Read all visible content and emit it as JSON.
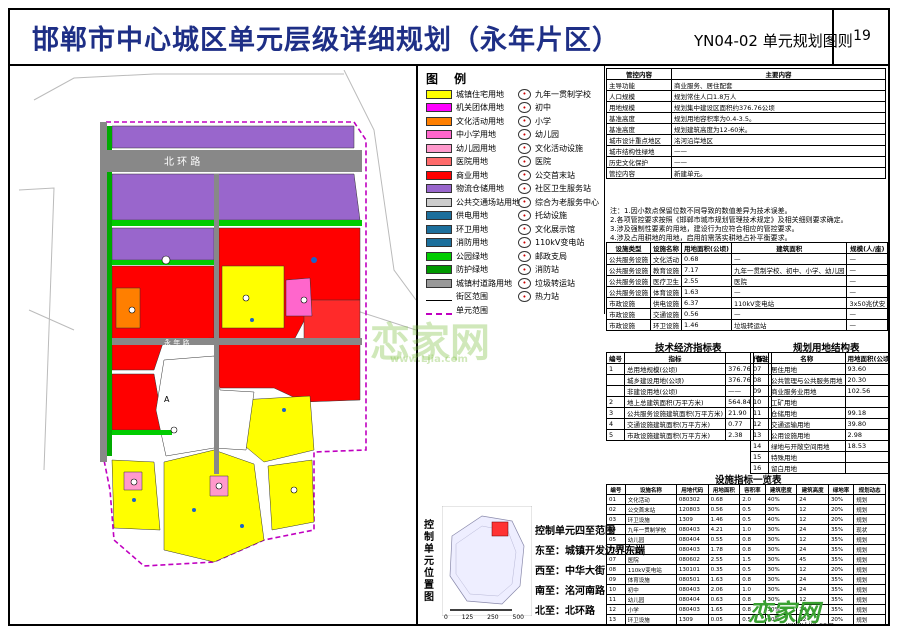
{
  "title": {
    "main": "邯郸市中心城区单元层级详细规划（永年片区）",
    "code": "YN04-02 单元规划图则",
    "page": "19"
  },
  "legend": {
    "heading": "图 例",
    "landuse": [
      {
        "label": "城镇住宅用地",
        "color": "#ffff00"
      },
      {
        "label": "机关团体用地",
        "color": "#ff00ff"
      },
      {
        "label": "文化活动用地",
        "color": "#ff7f00"
      },
      {
        "label": "中小学用地",
        "color": "#ff66cc"
      },
      {
        "label": "幼儿园用地",
        "color": "#ff99cc"
      },
      {
        "label": "医院用地",
        "color": "#ff6b6b"
      },
      {
        "label": "商业用地",
        "color": "#ff0000"
      },
      {
        "label": "物流仓储用地",
        "color": "#9966cc"
      },
      {
        "label": "公共交通场站用地",
        "color": "#cccccc"
      },
      {
        "label": "供电用地",
        "color": "#1c6f9c"
      },
      {
        "label": "环卫用地",
        "color": "#1c6f9c"
      },
      {
        "label": "消防用地",
        "color": "#1c6f9c"
      },
      {
        "label": "公园绿地",
        "color": "#00cc00"
      },
      {
        "label": "防护绿地",
        "color": "#009900"
      },
      {
        "label": "城镇村道路用地",
        "color": "#999999"
      },
      {
        "label": "街区范围",
        "color": "#ffffff"
      },
      {
        "label": "单元范围",
        "color": "#ffffff"
      }
    ],
    "facilities": [
      "九年一贯制学校",
      "初中",
      "小学",
      "幼儿园",
      "文化活动设施",
      "医院",
      "公交首末站",
      "社区卫生服务站",
      "综合为老服务中心",
      "托幼设施",
      "文化展示馆",
      "110kV变电站",
      "邮政支局",
      "消防站",
      "垃圾转运站",
      "热力站"
    ]
  },
  "control": {
    "headers": [
      "管控内容",
      "主要内容"
    ],
    "rows": [
      [
        "主导功能",
        "商业服务、居住配套"
      ],
      [
        "人口规模",
        "规划常住人口1.8万人"
      ],
      [
        "用地规模",
        "规划集中建设区面积约376.76公顷"
      ],
      [
        "基准高度",
        "规划用地容积率为0.4-3.5。"
      ],
      [
        "基准高度",
        "规划建筑高度为12-60米。"
      ],
      [
        "城市设计重点地区",
        "洺河沿岸地区"
      ],
      [
        "城市结构性绿地",
        "——"
      ],
      [
        "历史文化保护",
        "——"
      ],
      [
        "管控内容",
        "新建单元。"
      ]
    ],
    "side_labels": [
      "规模管控",
      "重点区域",
      "城市更新"
    ]
  },
  "notes": [
    "注：1.因小数点保留位数不同导致的数值差异为技术误差。",
    "2.各项管控要求按照《邯郸市城市规划管理技术规定》及相关细则要求确定。",
    "3.涉及强制性要素的用地，建设行为应符合相应的管控要求。",
    "4.涉及占用耕地的用地，启用前需落实耕地占补平衡要求。"
  ],
  "facility_table": {
    "headers": [
      "设施类型",
      "设施名称",
      "用地面积(公顷)",
      "建筑面积",
      "规模(人/座)",
      "数量",
      "规划动态"
    ],
    "rows": [
      [
        "公共服务设施",
        "文化活动",
        "0.68",
        "—",
        "—",
        "1",
        "规划"
      ],
      [
        "公共服务设施",
        "教育设施",
        "7.17",
        "九年一贯制学校、初中、小学、幼儿园",
        "—",
        "9",
        "现状/规划"
      ],
      [
        "公共服务设施",
        "医疗卫生",
        "2.55",
        "医院",
        "—",
        "1",
        "规划"
      ],
      [
        "公共服务设施",
        "体育设施",
        "1.63",
        "—",
        "—",
        "1",
        "规划"
      ],
      [
        "市政设施",
        "供电设施",
        "6.37",
        "110kV变电站",
        "3x50兆伏安",
        "1",
        "规划"
      ],
      [
        "市政设施",
        "交通设施",
        "0.56",
        "—",
        "—",
        "1",
        "规划"
      ],
      [
        "市政设施",
        "环卫设施",
        "1.46",
        "垃圾转运站",
        "—",
        "1",
        "规划"
      ]
    ]
  },
  "econ": {
    "title": "技术经济指标表",
    "headers": [
      "编号",
      "指标",
      "",
      "备注"
    ],
    "rows": [
      [
        "1",
        "总用地规模(公顷)",
        "376.76",
        ""
      ],
      [
        "",
        "城乡建设用地(公顷)",
        "376.76",
        ""
      ],
      [
        "",
        "非建设用地(公顷)",
        "——",
        ""
      ],
      [
        "2",
        "地上总建筑面积(万平方米)",
        "564.84",
        ""
      ],
      [
        "3",
        "公共服务设施建筑面积(万平方米)",
        "21.90",
        ""
      ],
      [
        "4",
        "交通设施建筑面积(万平方米)",
        "0.77",
        ""
      ],
      [
        "5",
        "市政设施建筑面积(万平方米)",
        "2.38",
        ""
      ]
    ]
  },
  "landuse_table": {
    "title": "规划用地结构表",
    "headers": [
      "代码",
      "名称",
      "用地面积(公顷)",
      "占总用地比例(%)"
    ],
    "rows": [
      [
        "07",
        "居住用地",
        "93.60",
        "24.79"
      ],
      [
        "08",
        "公共管理与公共服务用地",
        "20.30",
        "5.39"
      ],
      [
        "09",
        "商业服务业用地",
        "102.56",
        "27.22"
      ],
      [
        "10",
        "工矿用地",
        "",
        ""
      ],
      [
        "11",
        "仓储用地",
        "99.18",
        "26.33"
      ],
      [
        "12",
        "交通运输用地",
        "39.80",
        "10.56"
      ],
      [
        "13",
        "公用设施用地",
        "2.98",
        "0.79"
      ],
      [
        "14",
        "绿地与开敞空间用地",
        "18.53",
        "4.92"
      ],
      [
        "15",
        "特殊用地",
        "",
        ""
      ],
      [
        "16",
        "留白用地",
        "",
        ""
      ]
    ]
  },
  "index_table": {
    "title": "设施指标一览表",
    "headers": [
      "编号",
      "设施名称",
      "用地代码",
      "用地面积",
      "容积率",
      "建筑密度",
      "建筑高度",
      "绿地率",
      "规划动态"
    ],
    "rows": [
      [
        "01",
        "文化活动",
        "080302",
        "0.68",
        "2.0",
        "40%",
        "24",
        "30%",
        "规划"
      ],
      [
        "02",
        "公交首末站",
        "120803",
        "0.56",
        "0.5",
        "30%",
        "12",
        "20%",
        "规划"
      ],
      [
        "03",
        "环卫设施",
        "1309",
        "1.46",
        "0.5",
        "40%",
        "12",
        "20%",
        "规划"
      ],
      [
        "04",
        "九年一贯制学校",
        "080403",
        "4.21",
        "1.0",
        "30%",
        "24",
        "35%",
        "现状"
      ],
      [
        "05",
        "幼儿园",
        "080404",
        "0.55",
        "0.8",
        "30%",
        "12",
        "35%",
        "规划"
      ],
      [
        "06",
        "小学",
        "080403",
        "1.78",
        "0.8",
        "30%",
        "24",
        "35%",
        "规划"
      ],
      [
        "07",
        "医院",
        "080602",
        "2.55",
        "1.5",
        "30%",
        "45",
        "35%",
        "规划"
      ],
      [
        "08",
        "110kV变电站",
        "130101",
        "0.35",
        "0.5",
        "30%",
        "12",
        "20%",
        "规划"
      ],
      [
        "09",
        "体育设施",
        "080501",
        "1.63",
        "0.8",
        "30%",
        "24",
        "35%",
        "规划"
      ],
      [
        "10",
        "初中",
        "080403",
        "2.06",
        "1.0",
        "30%",
        "24",
        "35%",
        "规划"
      ],
      [
        "11",
        "幼儿园",
        "080404",
        "0.63",
        "0.8",
        "30%",
        "12",
        "35%",
        "规划"
      ],
      [
        "12",
        "小学",
        "080403",
        "1.65",
        "0.8",
        "30%",
        "24",
        "35%",
        "规划"
      ],
      [
        "13",
        "环卫设施",
        "1309",
        "0.05",
        "0.5",
        "30%",
        "12",
        "20%",
        "规划"
      ]
    ]
  },
  "inset": {
    "label": "控制单元位置图",
    "scale": [
      "0",
      "125",
      "250",
      "500"
    ]
  },
  "boundaries": {
    "title": "控制单元四至范围",
    "items": [
      "东至：城镇开发边界东端",
      "西至：中华大街",
      "南至：洺河南路",
      "北至：北环路"
    ]
  },
  "map": {
    "roads": {
      "north": "北 环 路",
      "middle": "永 年 路",
      "west": "中 华 大 街"
    },
    "colors": {
      "residential": "#ffff00",
      "commercial": "#ff0000",
      "logistics": "#9966cc",
      "green": "#00cc00",
      "road": "#999999"
    }
  },
  "watermark": {
    "text": "恋家网",
    "url": "www.Ljia.com"
  }
}
